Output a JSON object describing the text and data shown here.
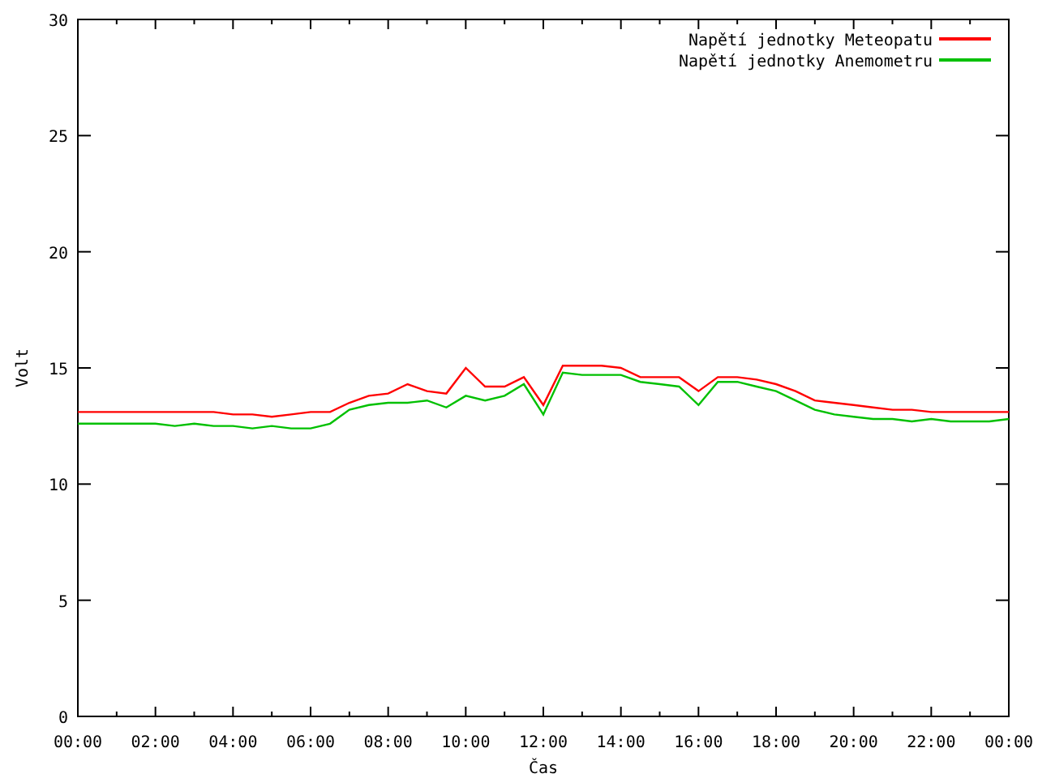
{
  "chart_data": {
    "type": "line",
    "xlabel": "Čas",
    "ylabel": "Volt",
    "x": [
      0,
      0.5,
      1,
      1.5,
      2,
      2.5,
      3,
      3.5,
      4,
      4.5,
      5,
      5.5,
      6,
      6.5,
      7,
      7.5,
      8,
      8.5,
      9,
      9.5,
      10,
      10.5,
      11,
      11.5,
      12,
      12.5,
      13,
      13.5,
      14,
      14.5,
      15,
      15.5,
      16,
      16.5,
      17,
      17.5,
      18,
      18.5,
      19,
      19.5,
      20,
      20.5,
      21,
      21.5,
      22,
      22.5,
      23,
      23.5,
      24
    ],
    "legend": "upper right",
    "xlim": [
      0,
      24
    ],
    "ylim": [
      0,
      30
    ],
    "xticks": [
      {
        "value": 0,
        "label": "00:00"
      },
      {
        "value": 2,
        "label": "02:00"
      },
      {
        "value": 4,
        "label": "04:00"
      },
      {
        "value": 6,
        "label": "06:00"
      },
      {
        "value": 8,
        "label": "08:00"
      },
      {
        "value": 10,
        "label": "10:00"
      },
      {
        "value": 12,
        "label": "12:00"
      },
      {
        "value": 14,
        "label": "14:00"
      },
      {
        "value": 16,
        "label": "16:00"
      },
      {
        "value": 18,
        "label": "18:00"
      },
      {
        "value": 20,
        "label": "20:00"
      },
      {
        "value": 22,
        "label": "22:00"
      },
      {
        "value": 24,
        "label": "00:00"
      }
    ],
    "yticks": [
      0,
      5,
      10,
      15,
      20,
      25,
      30
    ],
    "series": [
      {
        "name": "Napětí jednotky Meteopatu",
        "color": "#ff0000",
        "values": [
          13.1,
          13.1,
          13.1,
          13.1,
          13.1,
          13.1,
          13.1,
          13.1,
          13.0,
          13.0,
          12.9,
          13.0,
          13.1,
          13.1,
          13.5,
          13.8,
          13.9,
          14.3,
          14.0,
          13.9,
          15.0,
          14.2,
          14.2,
          14.6,
          13.4,
          15.1,
          15.1,
          15.1,
          15.0,
          14.6,
          14.6,
          14.6,
          14.0,
          14.6,
          14.6,
          14.5,
          14.3,
          14.0,
          13.6,
          13.5,
          13.4,
          13.3,
          13.2,
          13.2,
          13.1,
          13.1,
          13.1,
          13.1,
          13.1
        ]
      },
      {
        "name": "Napětí jednotky Anemometru",
        "color": "#00c000",
        "values": [
          12.6,
          12.6,
          12.6,
          12.6,
          12.6,
          12.5,
          12.6,
          12.5,
          12.5,
          12.4,
          12.5,
          12.4,
          12.4,
          12.6,
          13.2,
          13.4,
          13.5,
          13.5,
          13.6,
          13.3,
          13.8,
          13.6,
          13.8,
          14.3,
          13.0,
          14.8,
          14.7,
          14.7,
          14.7,
          14.4,
          14.3,
          14.2,
          13.4,
          14.4,
          14.4,
          14.2,
          14.0,
          13.6,
          13.2,
          13.0,
          12.9,
          12.8,
          12.8,
          12.7,
          12.8,
          12.7,
          12.7,
          12.7,
          12.8
        ]
      }
    ]
  }
}
